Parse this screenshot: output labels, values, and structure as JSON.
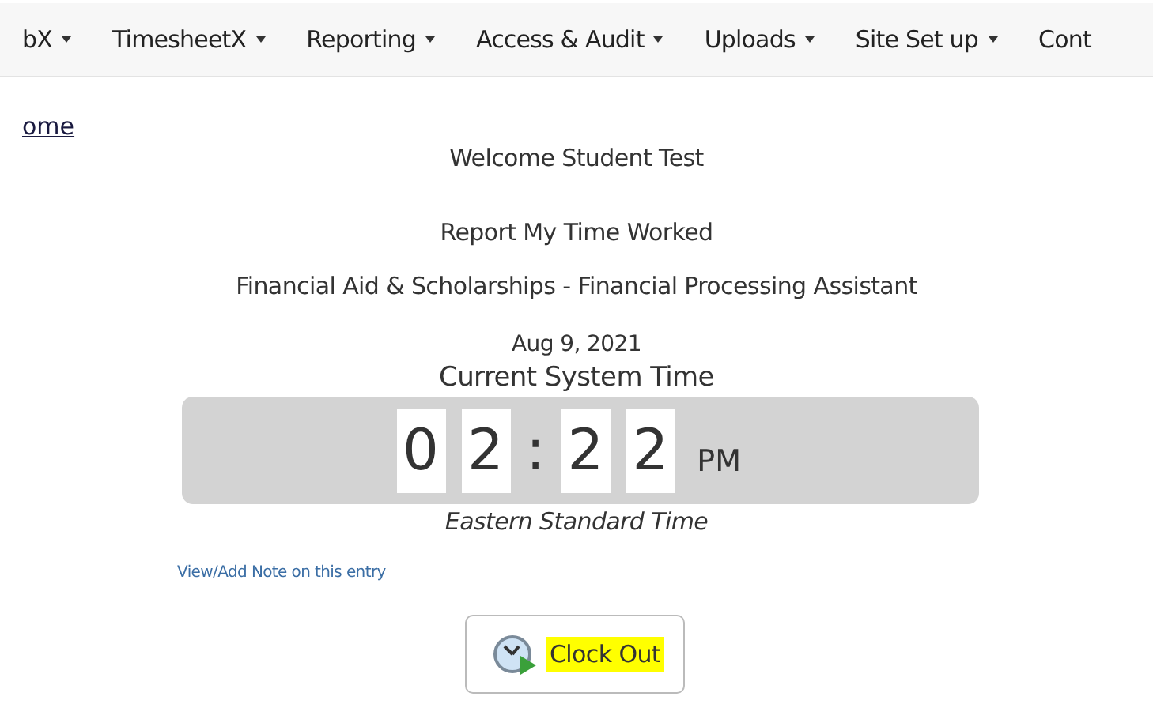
{
  "nav": {
    "items": [
      {
        "label": "bX",
        "dropdown": true
      },
      {
        "label": "TimesheetX",
        "dropdown": true
      },
      {
        "label": "Reporting",
        "dropdown": true
      },
      {
        "label": "Access & Audit",
        "dropdown": true
      },
      {
        "label": "Uploads",
        "dropdown": true
      },
      {
        "label": "Site Set up",
        "dropdown": true
      },
      {
        "label": "Cont",
        "dropdown": false
      }
    ]
  },
  "breadcrumb": "ome",
  "welcome": "Welcome Student Test",
  "heading": "Report My Time Worked",
  "position": "Financial Aid & Scholarships - Financial Processing Assistant",
  "date": "Aug 9, 2021",
  "clock_title": "Current System Time",
  "clock": {
    "hour_digits": [
      "0",
      "2"
    ],
    "separator": ":",
    "minute_digits": [
      "2",
      "2"
    ],
    "meridiem": "PM"
  },
  "timezone": "Eastern Standard Time",
  "note_link": "View/Add Note on this entry",
  "clock_out_button": "Clock Out"
}
